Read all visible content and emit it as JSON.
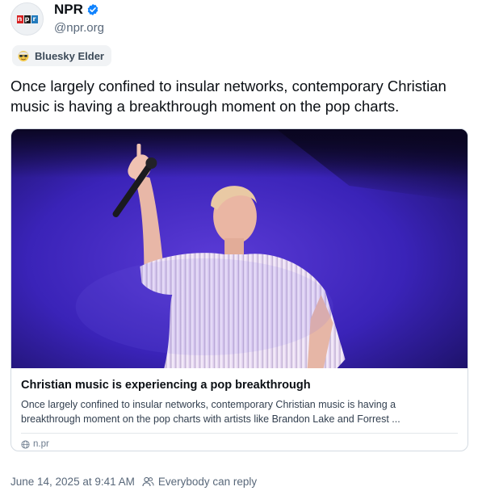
{
  "author": {
    "display_name": "NPR",
    "handle": "@npr.org",
    "avatar_logo_letters": [
      "n",
      "p",
      "r"
    ],
    "verified_icon": "verified-check-icon"
  },
  "badge": {
    "label": "Bluesky Elder",
    "icon": "elder-emoji-icon"
  },
  "post": {
    "text": "Once largely confined to insular networks, contemporary Christian music is having a breakthrough moment on the pop charts."
  },
  "link_card": {
    "image_description_icon": "concert-photo",
    "title": "Christian music is experiencing a pop breakthrough",
    "description": "Once largely confined to insular networks, contemporary Christian music is having a breakthrough moment on the pop charts with artists like Brandon Lake and Forrest ...",
    "domain": "n.pr"
  },
  "footer": {
    "timestamp": "June 14, 2025 at 9:41 AM",
    "reply_setting": "Everybody can reply"
  },
  "colors": {
    "text_primary": "#0b0f14",
    "text_secondary": "#59687a",
    "verified_blue": "#1083fe",
    "card_border": "#d4dbe2"
  }
}
